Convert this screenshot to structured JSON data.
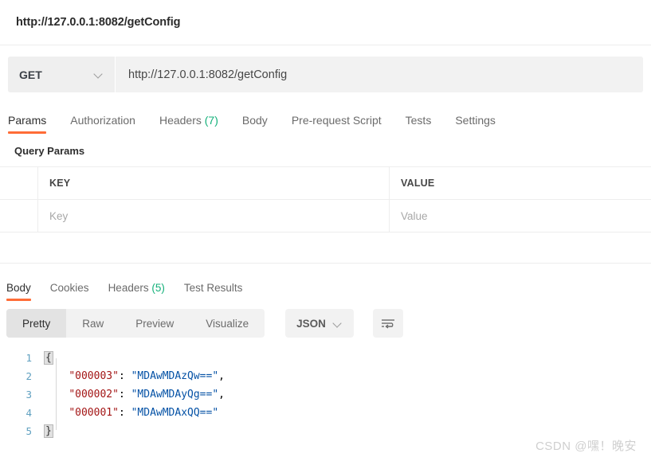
{
  "request": {
    "title": "http://127.0.0.1:8082/getConfig",
    "method": "GET",
    "url": "http://127.0.0.1:8082/getConfig",
    "tabs": [
      {
        "label": "Params",
        "count": "",
        "active": true
      },
      {
        "label": "Authorization",
        "count": "",
        "active": false
      },
      {
        "label": "Headers",
        "count": "(7)",
        "active": false
      },
      {
        "label": "Body",
        "count": "",
        "active": false
      },
      {
        "label": "Pre-request Script",
        "count": "",
        "active": false
      },
      {
        "label": "Tests",
        "count": "",
        "active": false
      },
      {
        "label": "Settings",
        "count": "",
        "active": false
      }
    ],
    "query_params": {
      "section_label": "Query Params",
      "columns": [
        "KEY",
        "VALUE"
      ],
      "rows": [
        {
          "key_placeholder": "Key",
          "value_placeholder": "Value"
        }
      ]
    }
  },
  "response": {
    "tabs": [
      {
        "label": "Body",
        "count": "",
        "active": true
      },
      {
        "label": "Cookies",
        "count": "",
        "active": false
      },
      {
        "label": "Headers",
        "count": "(5)",
        "active": false
      },
      {
        "label": "Test Results",
        "count": "",
        "active": false
      }
    ],
    "view_modes": [
      {
        "label": "Pretty",
        "active": true
      },
      {
        "label": "Raw",
        "active": false
      },
      {
        "label": "Preview",
        "active": false
      },
      {
        "label": "Visualize",
        "active": false
      }
    ],
    "format": "JSON",
    "wrap_icon": "word-wrap-icon",
    "body": {
      "language": "json",
      "lines": [
        {
          "n": "1",
          "open_brace": "{"
        },
        {
          "n": "2",
          "key": "\"000003\"",
          "colon": ": ",
          "value": "\"MDAwMDAzQw==\"",
          "comma": ","
        },
        {
          "n": "3",
          "key": "\"000002\"",
          "colon": ": ",
          "value": "\"MDAwMDAyQg==\"",
          "comma": ","
        },
        {
          "n": "4",
          "key": "\"000001\"",
          "colon": ": ",
          "value": "\"MDAwMDAxQQ==\"",
          "comma": ""
        },
        {
          "n": "5",
          "close_brace": "}"
        }
      ]
    }
  },
  "watermark": "CSDN @嘿！晚安",
  "colors": {
    "accent": "#ff6c37",
    "count_green": "#13b079",
    "json_key": "#a31515",
    "json_string": "#0451a5",
    "gutter": "#60a0c0"
  }
}
